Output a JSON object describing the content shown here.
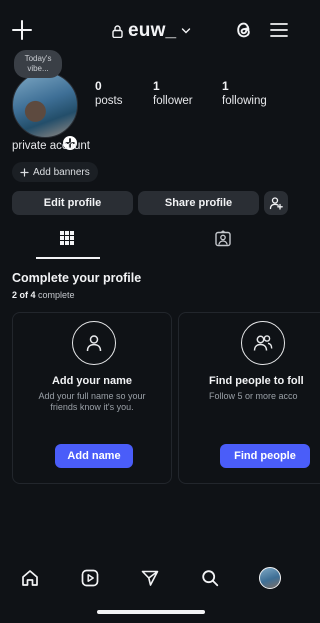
{
  "header": {
    "username": "euw_"
  },
  "profile": {
    "note": "Today's vibe...",
    "stats": [
      {
        "num": "0",
        "label": "posts"
      },
      {
        "num": "1",
        "label": "follower"
      },
      {
        "num": "1",
        "label": "following"
      }
    ],
    "bio": "private account",
    "banners_label": "Add banners"
  },
  "actions": {
    "edit_label": "Edit profile",
    "share_label": "Share profile"
  },
  "complete": {
    "title": "Complete your profile",
    "count": "2 of 4",
    "status": "complete",
    "cards": [
      {
        "title": "Add your name",
        "desc": "Add your full name so your friends know it's you.",
        "cta": "Add name"
      },
      {
        "title": "Find people to foll",
        "desc": "Follow 5 or more acco",
        "cta": "Find people"
      }
    ]
  },
  "icons": {
    "top": [
      "plus-icon",
      "lock-icon",
      "chevron-down-icon",
      "threads-icon",
      "menu-icon"
    ],
    "tabs": [
      "grid-icon",
      "tagged-icon"
    ],
    "nav": [
      "home-icon",
      "reels-icon",
      "send-icon",
      "search-icon",
      "profile-avatar"
    ]
  },
  "colors": {
    "background": "#0f1216",
    "button": "#2a2e34",
    "accent": "#4a5df9"
  }
}
